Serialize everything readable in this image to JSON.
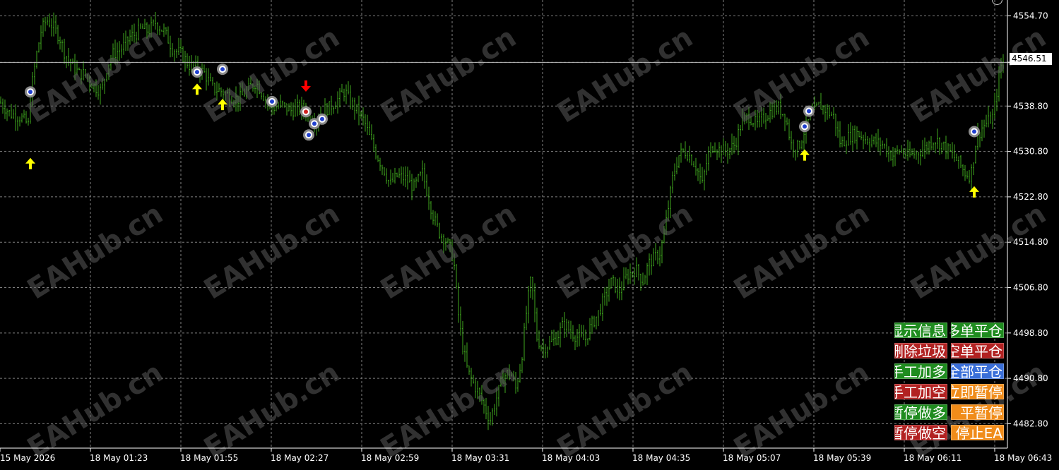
{
  "chart_data": {
    "type": "candlestick",
    "colors": {
      "background": "#000000",
      "bars": "#3fa81e",
      "grid": "#7f7f7f",
      "axis": "#ffffff",
      "buy_arrow": "#ffff00",
      "sell_arrow": "#ff0000"
    },
    "grid": "dashed",
    "ylim": [
      4478.5,
      4557.5
    ],
    "y_ticks": [
      "4554.70",
      "4546.51",
      "4538.80",
      "4530.80",
      "4522.80",
      "4514.80",
      "4506.80",
      "4498.80",
      "4490.80",
      "4482.80"
    ],
    "current_price": "4546.51",
    "x_ticks": [
      "15 May 2026",
      "18 May 01:23",
      "18 May 01:55",
      "18 May 02:27",
      "18 May 02:59",
      "18 May 03:31",
      "18 May 04:03",
      "18 May 04:35",
      "18 May 05:07",
      "18 May 05:39",
      "18 May 06:11",
      "18 May 06:43"
    ],
    "watermark": "EAHub.cn",
    "price_path": [
      [
        0,
        4539.5
      ],
      [
        14,
        4537.5
      ],
      [
        30,
        4536.8
      ],
      [
        40,
        4535.5
      ],
      [
        44,
        4541.5
      ],
      [
        52,
        4548
      ],
      [
        58,
        4552
      ],
      [
        66,
        4554
      ],
      [
        74,
        4553
      ],
      [
        84,
        4551
      ],
      [
        92,
        4548
      ],
      [
        102,
        4546
      ],
      [
        112,
        4544.5
      ],
      [
        120,
        4544.5
      ],
      [
        128,
        4543
      ],
      [
        136,
        4542
      ],
      [
        144,
        4541.5
      ],
      [
        152,
        4546
      ],
      [
        160,
        4548
      ],
      [
        168,
        4548.5
      ],
      [
        176,
        4549.5
      ],
      [
        184,
        4551
      ],
      [
        192,
        4551.5
      ],
      [
        200,
        4552.5
      ],
      [
        210,
        4552
      ],
      [
        220,
        4553.5
      ],
      [
        232,
        4552
      ],
      [
        244,
        4549
      ],
      [
        256,
        4548
      ],
      [
        268,
        4546
      ],
      [
        280,
        4545.5
      ],
      [
        290,
        4544.5
      ],
      [
        300,
        4542
      ],
      [
        312,
        4541.5
      ],
      [
        326,
        4540.5
      ],
      [
        338,
        4540
      ],
      [
        350,
        4541.5
      ],
      [
        362,
        4543
      ],
      [
        374,
        4540.5
      ],
      [
        386,
        4538.5
      ],
      [
        398,
        4539
      ],
      [
        412,
        4538
      ],
      [
        424,
        4538.5
      ],
      [
        432,
        4538
      ],
      [
        440,
        4537
      ],
      [
        448,
        4536
      ],
      [
        456,
        4538
      ],
      [
        466,
        4538.5
      ],
      [
        478,
        4540
      ],
      [
        488,
        4541.5
      ],
      [
        496,
        4539.5
      ],
      [
        506,
        4538
      ],
      [
        516,
        4536
      ],
      [
        524,
        4533
      ],
      [
        534,
        4530
      ],
      [
        544,
        4527.5
      ],
      [
        552,
        4525
      ],
      [
        562,
        4526.5
      ],
      [
        574,
        4526
      ],
      [
        586,
        4524.5
      ],
      [
        598,
        4527
      ],
      [
        606,
        4523
      ],
      [
        614,
        4519
      ],
      [
        622,
        4516.5
      ],
      [
        632,
        4515
      ],
      [
        642,
        4512
      ],
      [
        648,
        4503
      ],
      [
        654,
        4497
      ],
      [
        662,
        4492
      ],
      [
        670,
        4490
      ],
      [
        680,
        4487.5
      ],
      [
        688,
        4485
      ],
      [
        694,
        4483.5
      ],
      [
        702,
        4487
      ],
      [
        712,
        4491
      ],
      [
        722,
        4492
      ],
      [
        730,
        4489
      ],
      [
        738,
        4494
      ],
      [
        746,
        4503.5
      ],
      [
        752,
        4508.5
      ],
      [
        760,
        4498
      ],
      [
        768,
        4496
      ],
      [
        778,
        4497
      ],
      [
        788,
        4498
      ],
      [
        798,
        4500.5
      ],
      [
        808,
        4499
      ],
      [
        818,
        4498
      ],
      [
        828,
        4497.5
      ],
      [
        836,
        4500
      ],
      [
        846,
        4502
      ],
      [
        856,
        4505
      ],
      [
        866,
        4508
      ],
      [
        876,
        4506
      ],
      [
        888,
        4509
      ],
      [
        900,
        4510
      ],
      [
        910,
        4508
      ],
      [
        918,
        4511
      ],
      [
        926,
        4512
      ],
      [
        934,
        4513
      ],
      [
        940,
        4516
      ],
      [
        946,
        4521
      ],
      [
        952,
        4526
      ],
      [
        960,
        4530
      ],
      [
        968,
        4531
      ],
      [
        976,
        4530
      ],
      [
        986,
        4528
      ],
      [
        994,
        4525
      ],
      [
        1002,
        4530
      ],
      [
        1010,
        4532
      ],
      [
        1020,
        4531
      ],
      [
        1030,
        4531
      ],
      [
        1040,
        4532
      ],
      [
        1050,
        4536
      ],
      [
        1060,
        4537
      ],
      [
        1072,
        4535.5
      ],
      [
        1082,
        4537
      ],
      [
        1092,
        4538
      ],
      [
        1102,
        4538.5
      ],
      [
        1112,
        4537
      ],
      [
        1120,
        4532
      ],
      [
        1130,
        4531.5
      ],
      [
        1140,
        4535
      ],
      [
        1150,
        4537.5
      ],
      [
        1160,
        4539
      ],
      [
        1170,
        4538
      ],
      [
        1180,
        4537
      ],
      [
        1190,
        4532
      ],
      [
        1202,
        4533.5
      ],
      [
        1214,
        4534
      ],
      [
        1226,
        4533
      ],
      [
        1238,
        4532.5
      ],
      [
        1250,
        4532
      ],
      [
        1262,
        4530
      ],
      [
        1274,
        4531
      ],
      [
        1286,
        4530
      ],
      [
        1298,
        4530.5
      ],
      [
        1310,
        4531.5
      ],
      [
        1322,
        4533
      ],
      [
        1334,
        4532
      ],
      [
        1346,
        4530.5
      ],
      [
        1356,
        4529
      ],
      [
        1366,
        4527
      ],
      [
        1374,
        4526.5
      ],
      [
        1382,
        4533
      ],
      [
        1390,
        4535
      ],
      [
        1398,
        4536
      ],
      [
        1406,
        4537
      ],
      [
        1414,
        4544
      ],
      [
        1418,
        4546.5
      ]
    ],
    "signals": [
      {
        "side": "buy",
        "x": 43,
        "arrow_price": 4528.8,
        "marker_price": 4541.3
      },
      {
        "side": "buy",
        "x": 279,
        "arrow_price": 4541.9,
        "marker_price": 4544.8
      },
      {
        "side": "buy",
        "x": 315,
        "arrow_price": 4539.2,
        "marker_price": 4545.3
      },
      {
        "side": "none",
        "x": 385,
        "arrow_price": null,
        "marker_price": 4539.6
      },
      {
        "side": "sell",
        "x": 433,
        "arrow_price": 4542.2,
        "marker_price": 4537.8
      },
      {
        "side": "none",
        "x": 445,
        "arrow_price": null,
        "marker_price": 4535.7
      },
      {
        "side": "none",
        "x": 456,
        "arrow_price": null,
        "marker_price": 4536.5
      },
      {
        "side": "none",
        "x": 437,
        "arrow_price": null,
        "marker_price": 4533.7
      },
      {
        "side": "buy",
        "x": 1139,
        "arrow_price": 4530.3,
        "marker_price": 4535.2
      },
      {
        "side": "none",
        "x": 1145,
        "arrow_price": null,
        "marker_price": 4537.9
      },
      {
        "side": "buy",
        "x": 1379,
        "arrow_price": 4523.8,
        "marker_price": 4534.3
      }
    ]
  },
  "panel": {
    "buttons": [
      {
        "label": "显示信息",
        "color": "#1f8c1f"
      },
      {
        "label": "多单平仓",
        "color": "#1f8c1f"
      },
      {
        "label": "删除垃圾",
        "color": "#b22222"
      },
      {
        "label": "空单平仓",
        "color": "#b22222"
      },
      {
        "label": "手工加多",
        "color": "#1f8c1f"
      },
      {
        "label": "全部平仓",
        "color": "#3a6fd8"
      },
      {
        "label": "手工加空",
        "color": "#b22222"
      },
      {
        "label": "立即暂停",
        "color": "#f08c1a"
      },
      {
        "label": "暂停做多",
        "color": "#1f8c1f"
      },
      {
        "label": "平暂停",
        "color": "#f08c1a"
      },
      {
        "label": "暂停做空",
        "color": "#b22222"
      },
      {
        "label": "停止EA",
        "color": "#f08c1a"
      }
    ]
  }
}
